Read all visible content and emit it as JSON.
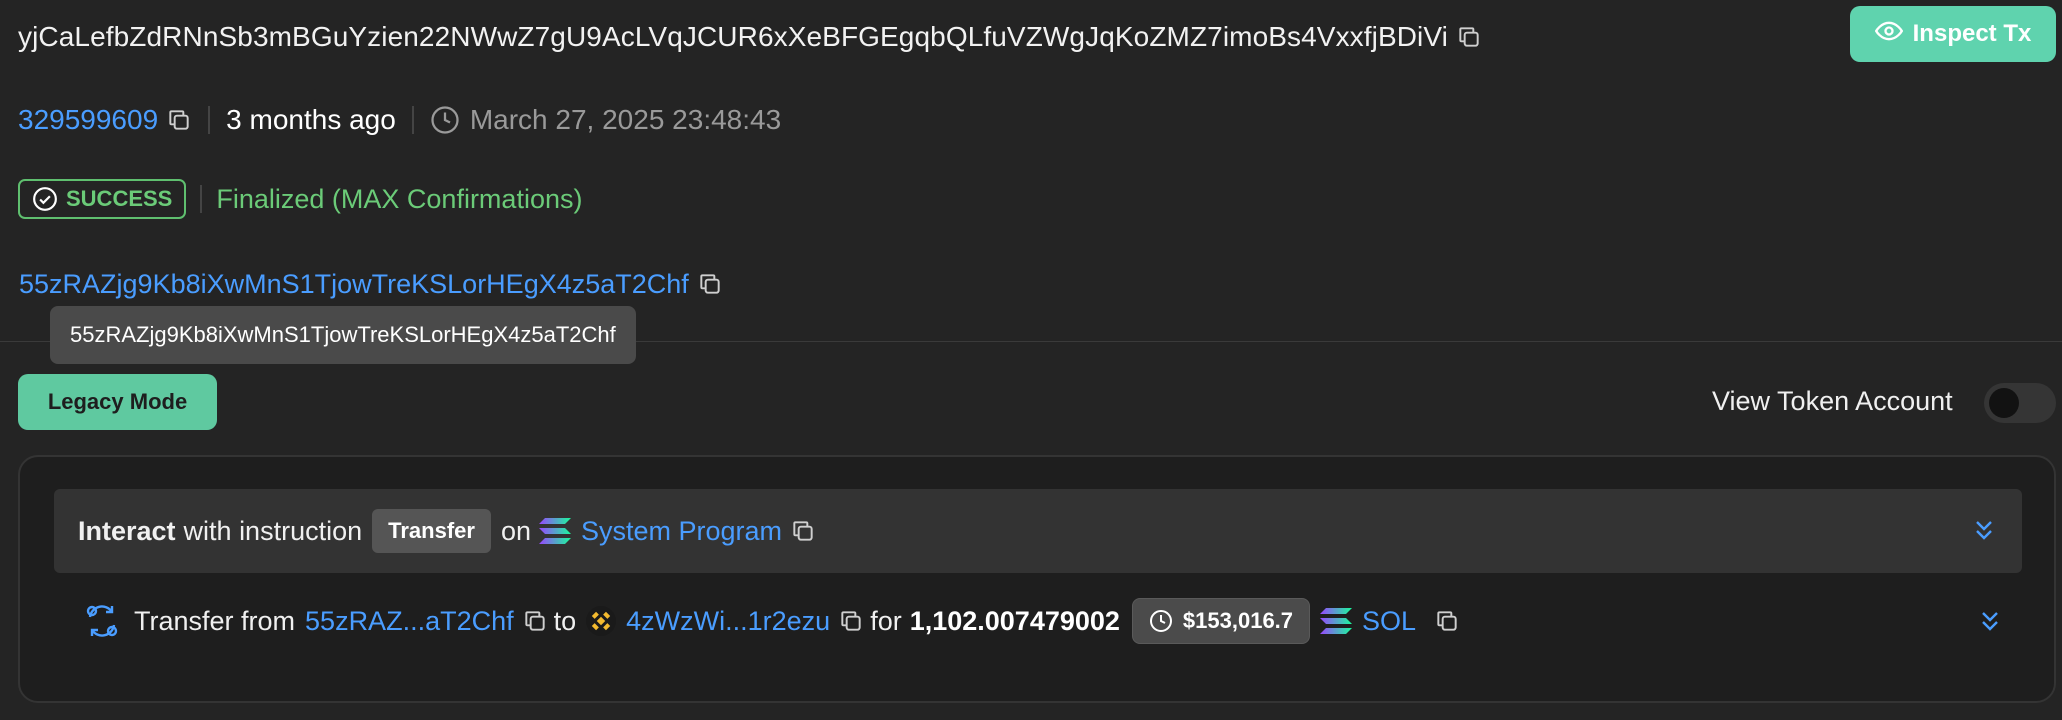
{
  "header": {
    "tx_signature": "yjCaLefbZdRNnSb3mBGuYzien22NWwZ7gU9AcLVqJCUR6xXeBFGEgqbQLfuVZWgJqKoZMZ7imoBs4VxxfjBDiVi",
    "inspect_label": "Inspect Tx"
  },
  "meta": {
    "block": "329599609",
    "age": "3 months ago",
    "timestamp": "March 27, 2025 23:48:43"
  },
  "status": {
    "result": "SUCCESS",
    "confirmation": "Finalized (MAX Confirmations)",
    "color": "#6bcb78"
  },
  "signer": {
    "address": "55zRAZjg9Kb8iXwMnS1TjowTreKSLorHEgX4z5aT2Chf",
    "tooltip": "55zRAZjg9Kb8iXwMnS1TjowTreKSLorHEgX4z5aT2Chf"
  },
  "controls": {
    "legacy_label": "Legacy Mode",
    "view_token_label": "View Token Account"
  },
  "instruction": {
    "interact": "Interact",
    "with_instruction": "with instruction",
    "name": "Transfer",
    "on": "on",
    "program": "System Program"
  },
  "transfer": {
    "label": "Transfer from",
    "from": "55zRAZ...aT2Chf",
    "to_word": "to",
    "to": "4zWzWi...1r2ezu",
    "for_word": "for",
    "amount": "1,102.007479002",
    "usd": "$153,016.7",
    "token": "SOL"
  },
  "colors": {
    "accent": "#5fd3ae",
    "link": "#4a9dff",
    "background": "#242424"
  }
}
